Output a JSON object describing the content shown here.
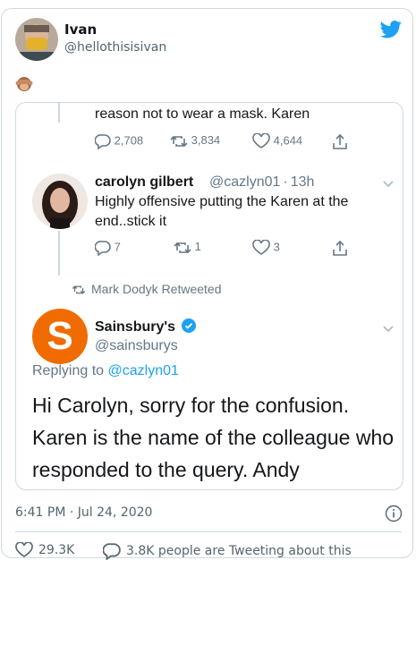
{
  "author": {
    "name": "Ivan",
    "handle": "@hellothisisivan"
  },
  "tweet_emoji": "🙈",
  "screenshot": {
    "top_text": "reason not to wear a mask. Karen",
    "top_actions": {
      "replies": "2,708",
      "retweets": "3,834",
      "likes": "4,644"
    },
    "reply": {
      "name": "carolyn gilbert",
      "handle": "@cazlyn01",
      "sep": "·",
      "time": "13h",
      "text": "Highly offensive putting the Karen at the end..stick it",
      "actions": {
        "replies": "7",
        "retweets": "1",
        "likes": "3"
      }
    },
    "retweeted_by": "Mark Dodyk Retweeted",
    "brand": {
      "logo_letter": "S",
      "name": "Sainsbury's",
      "handle": "@sainsburys",
      "replying_prefix": "Replying to ",
      "replying_handle": "@cazlyn01",
      "text": "Hi Carolyn, sorry for the confusion. Karen is the name of the colleague who responded to the query. Andy"
    }
  },
  "timestamp": "6:41 PM · Jul 24, 2020",
  "likes": "29.3K",
  "conversation": "3.8K people are Tweeting about this",
  "colors": {
    "twitter_blue": "#1da1f2",
    "sainsburys_orange": "#f06c00",
    "muted": "#536471"
  }
}
